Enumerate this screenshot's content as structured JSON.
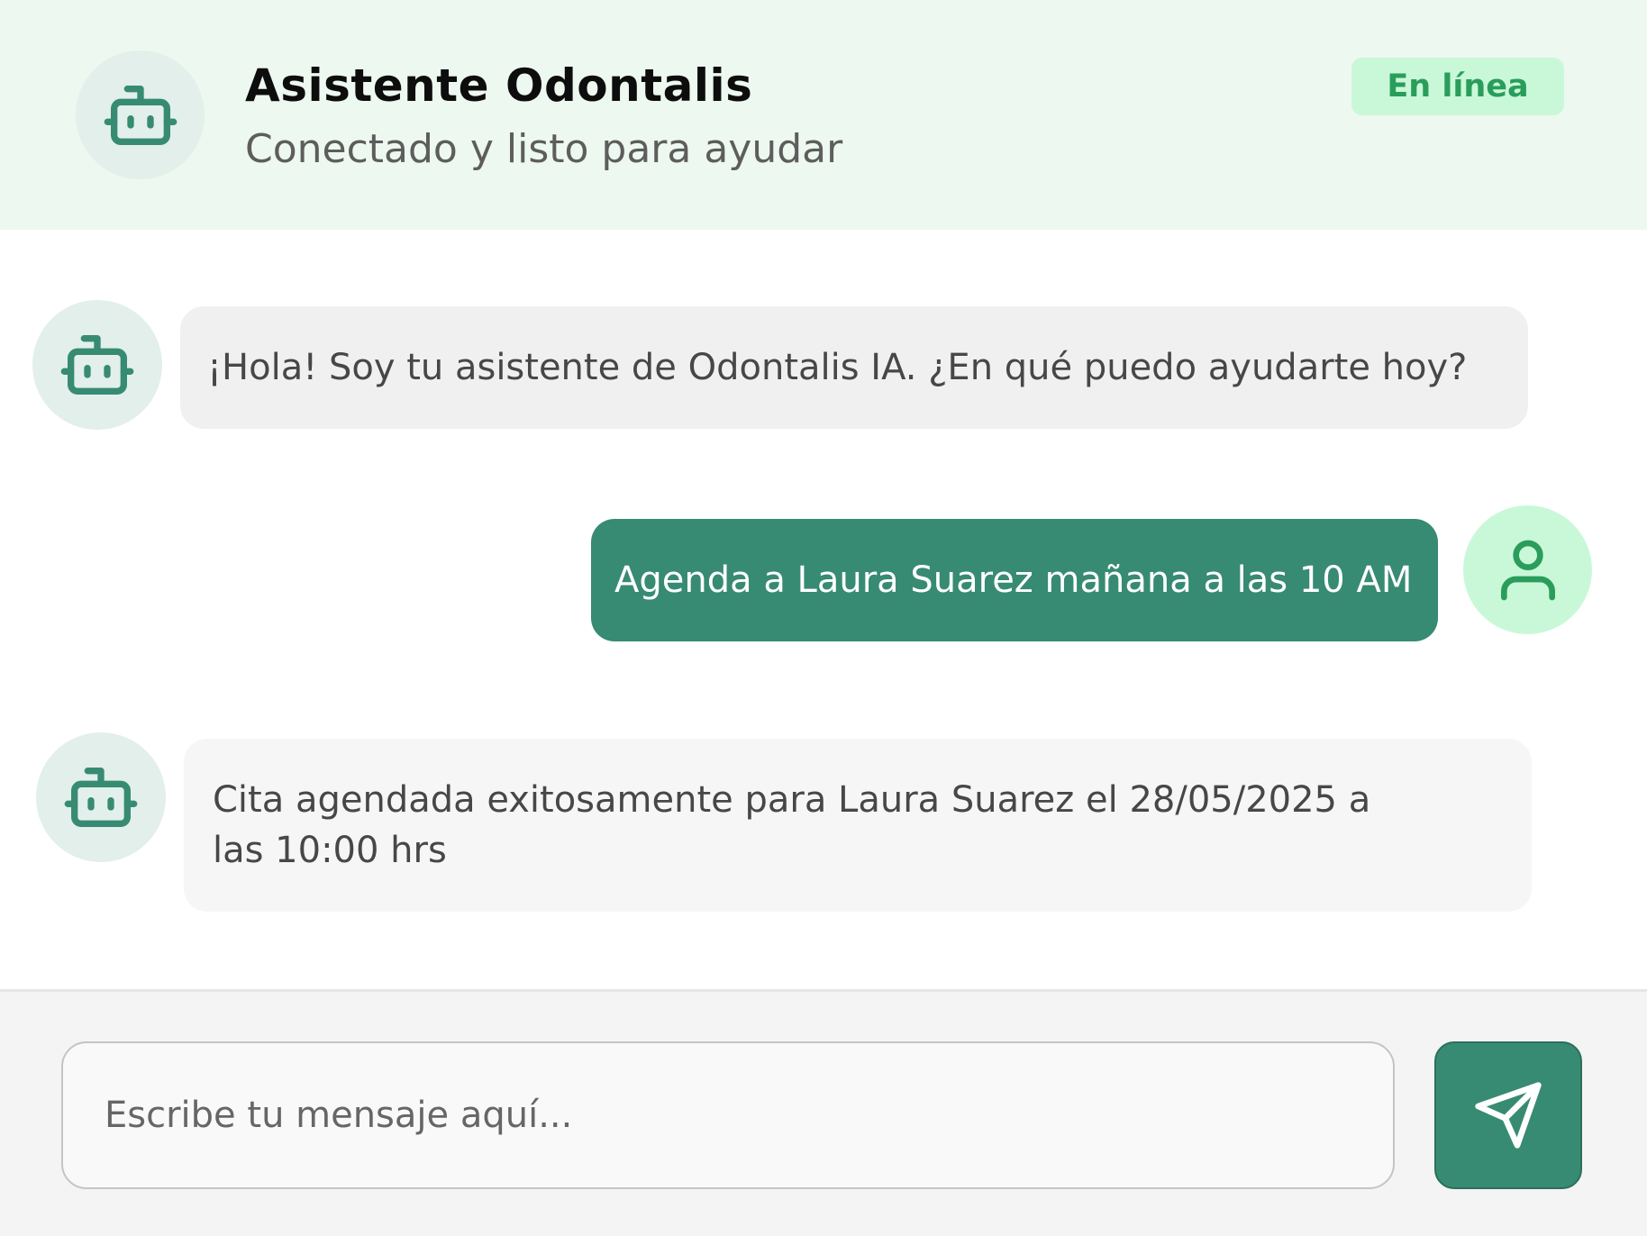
{
  "header": {
    "title": "Asistente Odontalis",
    "subtitle": "Conectado y listo para ayudar",
    "status": "En línea",
    "avatar_icon": "bot-icon"
  },
  "messages": [
    {
      "sender": "bot",
      "text": "¡Hola! Soy tu asistente de Odontalis IA. ¿En qué puedo ayudarte hoy?",
      "avatar_icon": "bot-icon"
    },
    {
      "sender": "user",
      "text": "Agenda a Laura Suarez mañana a las 10 AM",
      "avatar_icon": "user-icon"
    },
    {
      "sender": "bot",
      "text": "Cita agendada exitosamente para Laura Suarez el 28/05/2025 a las 10:00 hrs",
      "avatar_icon": "bot-icon"
    }
  ],
  "composer": {
    "placeholder": "Escribe tu mensaje aquí...",
    "value": "",
    "send_icon": "send-icon"
  },
  "colors": {
    "primary": "#378b72",
    "header_bg": "#edf8f0",
    "status_bg": "#c9f8d8",
    "status_text": "#2a9d5b",
    "bot_bubble": "#f0f0f0",
    "user_avatar_bg": "#c9f8d8",
    "bot_avatar_bg": "#e2efea"
  }
}
